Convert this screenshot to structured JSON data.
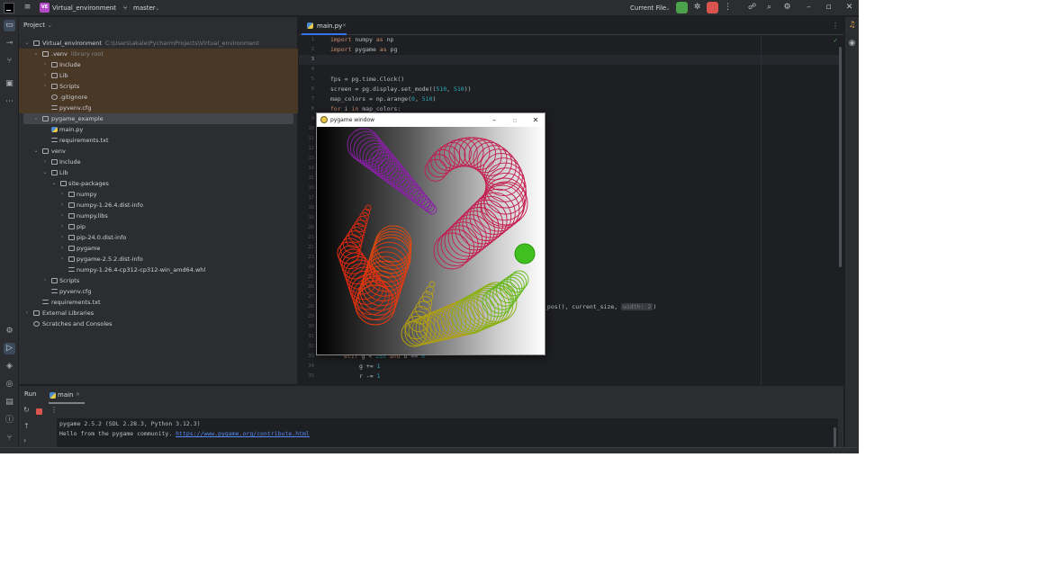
{
  "titlebar": {
    "project_badge": "VE",
    "project_name": "Virtual_environment",
    "branch": "master",
    "run_config": "Current File"
  },
  "project_panel": {
    "header": "Project",
    "items": [
      {
        "label": "Virtual_environment",
        "hint": "C:\\Users\\akale\\PycharmProjects\\Virtual_environment"
      },
      {
        "label": ".venv",
        "hint": "library root"
      },
      {
        "label": "Include"
      },
      {
        "label": "Lib"
      },
      {
        "label": "Scripts"
      },
      {
        "label": ".gitignore"
      },
      {
        "label": "pyvenv.cfg"
      },
      {
        "label": "pygame_example"
      },
      {
        "label": "main.py"
      },
      {
        "label": "requirements.txt"
      },
      {
        "label": "venv"
      },
      {
        "label": "Include"
      },
      {
        "label": "Lib"
      },
      {
        "label": "site-packages"
      },
      {
        "label": "numpy"
      },
      {
        "label": "numpy-1.26.4.dist-info"
      },
      {
        "label": "numpy.libs"
      },
      {
        "label": "pip"
      },
      {
        "label": "pip-24.0.dist-info"
      },
      {
        "label": "pygame"
      },
      {
        "label": "pygame-2.5.2.dist-info"
      },
      {
        "label": "numpy-1.26.4-cp312-cp312-win_amd64.whl"
      },
      {
        "label": "Scripts"
      },
      {
        "label": "pyvenv.cfg"
      },
      {
        "label": "requirements.txt"
      },
      {
        "label": "External Libraries"
      },
      {
        "label": "Scratches and Consoles"
      }
    ]
  },
  "editor": {
    "tab": "main.py",
    "line_numbers": [
      "1",
      "2",
      "3",
      "4",
      "5",
      "6",
      "7",
      "8",
      "9",
      "10",
      "11",
      "12",
      "13",
      "14",
      "15",
      "16",
      "17",
      "18",
      "19",
      "20",
      "21",
      "22",
      "23",
      "24",
      "25",
      "26",
      "27",
      "28",
      "29",
      "30",
      "31",
      "32",
      "33",
      "34",
      "35"
    ],
    "code": {
      "l1_kw": "import",
      "l1_rest": " numpy ",
      "l1_as": "as",
      "l1_alias": " np",
      "l2_kw": "import",
      "l2_rest": " pygame ",
      "l2_as": "as",
      "l2_alias": " pg",
      "l5": "fps = pg.time.Clock()",
      "l6_a": "screen = pg.display.set_mode((",
      "l6_n1": "510",
      "l6_b": ", ",
      "l6_n2": "510",
      "l6_c": "))",
      "l7_a": "map_colors = np.arange(",
      "l7_n1": "0",
      "l7_b": ", ",
      "l7_n2": "510",
      "l7_c": ")",
      "l8_kw": "for",
      "l8_a": " i ",
      "l8_in": "in",
      "l8_b": " map_colors:",
      "l28_a": "_pos(), current_size, ",
      "l28_hint": "width:",
      "l28_n": " 2",
      "l28_b": ")",
      "l33_kw": "elif",
      "l33_a": " g < ",
      "l33_n1": "255",
      "l33_and": " and",
      "l33_b": " b == ",
      "l33_n2": "0",
      "l34_a": "g += ",
      "l34_n": "1",
      "l35_a": "r -= ",
      "l35_n": "1"
    }
  },
  "run_panel": {
    "title": "Run",
    "tab": "main",
    "console_line1": "pygame 2.5.2 (SDL 2.28.3, Python 3.12.3)",
    "console_line2_prefix": "Hello from the pygame community. ",
    "console_link": "https://www.pygame.org/contribute.html"
  },
  "pygame_window": {
    "title": "pygame window"
  },
  "colors": {
    "accent": "#3574f0",
    "run_green": "#4ca14b",
    "stop_red": "#d9534f",
    "library_root_highlight": "#4a3826"
  }
}
